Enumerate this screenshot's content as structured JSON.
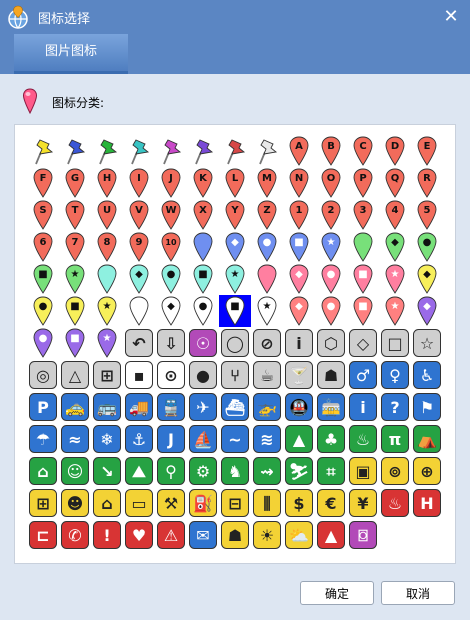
{
  "window": {
    "title": "图标选择",
    "close_glyph": "✕"
  },
  "tabs": [
    {
      "label": "图片图标",
      "active": true
    }
  ],
  "category": {
    "label": "图标分类:"
  },
  "buttons": {
    "ok": "确定",
    "cancel": "取消"
  },
  "selected_index": 71,
  "colors": {
    "titlebar": "#5b86c3",
    "selection": "#0000ff"
  },
  "icons": [
    {
      "kind": "thumbtack",
      "color": "#f5e12a"
    },
    {
      "kind": "thumbtack",
      "color": "#3b57d6"
    },
    {
      "kind": "thumbtack",
      "color": "#27b43a"
    },
    {
      "kind": "thumbtack",
      "color": "#38c4c4"
    },
    {
      "kind": "thumbtack",
      "color": "#c94ac9"
    },
    {
      "kind": "thumbtack",
      "color": "#7a4ad6"
    },
    {
      "kind": "thumbtack",
      "color": "#d64848"
    },
    {
      "kind": "thumbtack",
      "color": "#e8e8e8"
    },
    {
      "kind": "pin",
      "color": "#f26b5b",
      "glyph": "A"
    },
    {
      "kind": "pin",
      "color": "#f26b5b",
      "glyph": "B"
    },
    {
      "kind": "pin",
      "color": "#f26b5b",
      "glyph": "C"
    },
    {
      "kind": "pin",
      "color": "#f26b5b",
      "glyph": "D"
    },
    {
      "kind": "pin",
      "color": "#f26b5b",
      "glyph": "E"
    },
    {
      "kind": "pin",
      "color": "#f26b5b",
      "glyph": "F"
    },
    {
      "kind": "pin",
      "color": "#f26b5b",
      "glyph": "G"
    },
    {
      "kind": "pin",
      "color": "#f26b5b",
      "glyph": "H"
    },
    {
      "kind": "pin",
      "color": "#f26b5b",
      "glyph": "I"
    },
    {
      "kind": "pin",
      "color": "#f26b5b",
      "glyph": "J"
    },
    {
      "kind": "pin",
      "color": "#f26b5b",
      "glyph": "K"
    },
    {
      "kind": "pin",
      "color": "#f26b5b",
      "glyph": "L"
    },
    {
      "kind": "pin",
      "color": "#f26b5b",
      "glyph": "M"
    },
    {
      "kind": "pin",
      "color": "#f26b5b",
      "glyph": "N"
    },
    {
      "kind": "pin",
      "color": "#f26b5b",
      "glyph": "O"
    },
    {
      "kind": "pin",
      "color": "#f26b5b",
      "glyph": "P"
    },
    {
      "kind": "pin",
      "color": "#f26b5b",
      "glyph": "Q"
    },
    {
      "kind": "pin",
      "color": "#f26b5b",
      "glyph": "R"
    },
    {
      "kind": "pin",
      "color": "#f26b5b",
      "glyph": "S"
    },
    {
      "kind": "pin",
      "color": "#f26b5b",
      "glyph": "T"
    },
    {
      "kind": "pin",
      "color": "#f26b5b",
      "glyph": "U"
    },
    {
      "kind": "pin",
      "color": "#f26b5b",
      "glyph": "V"
    },
    {
      "kind": "pin",
      "color": "#f26b5b",
      "glyph": "W"
    },
    {
      "kind": "pin",
      "color": "#f26b5b",
      "glyph": "X"
    },
    {
      "kind": "pin",
      "color": "#f26b5b",
      "glyph": "Y"
    },
    {
      "kind": "pin",
      "color": "#f26b5b",
      "glyph": "Z"
    },
    {
      "kind": "pin",
      "color": "#f26b5b",
      "glyph": "1"
    },
    {
      "kind": "pin",
      "color": "#f26b5b",
      "glyph": "2"
    },
    {
      "kind": "pin",
      "color": "#f26b5b",
      "glyph": "3"
    },
    {
      "kind": "pin",
      "color": "#f26b5b",
      "glyph": "4"
    },
    {
      "kind": "pin",
      "color": "#f26b5b",
      "glyph": "5"
    },
    {
      "kind": "pin",
      "color": "#f26b5b",
      "glyph": "6"
    },
    {
      "kind": "pin",
      "color": "#f26b5b",
      "glyph": "7"
    },
    {
      "kind": "pin",
      "color": "#f26b5b",
      "glyph": "8"
    },
    {
      "kind": "pin",
      "color": "#f26b5b",
      "glyph": "9"
    },
    {
      "kind": "pin",
      "color": "#f26b5b",
      "glyph": "10"
    },
    {
      "kind": "pin",
      "color": "#6f8ff0",
      "glyph": ""
    },
    {
      "kind": "pin",
      "color": "#6f8ff0",
      "glyph": "◆"
    },
    {
      "kind": "pin",
      "color": "#6f8ff0",
      "glyph": "●"
    },
    {
      "kind": "pin",
      "color": "#6f8ff0",
      "glyph": "■"
    },
    {
      "kind": "pin",
      "color": "#6f8ff0",
      "glyph": "★"
    },
    {
      "kind": "pin",
      "color": "#78e07a",
      "glyph": ""
    },
    {
      "kind": "pin",
      "color": "#78e07a",
      "glyph": "◆"
    },
    {
      "kind": "pin",
      "color": "#78e07a",
      "glyph": "●"
    },
    {
      "kind": "pin",
      "color": "#78e07a",
      "glyph": "■"
    },
    {
      "kind": "pin",
      "color": "#78e07a",
      "glyph": "★"
    },
    {
      "kind": "pin",
      "color": "#8ef0e0",
      "glyph": ""
    },
    {
      "kind": "pin",
      "color": "#8ef0e0",
      "glyph": "◆"
    },
    {
      "kind": "pin",
      "color": "#8ef0e0",
      "glyph": "●"
    },
    {
      "kind": "pin",
      "color": "#8ef0e0",
      "glyph": "■"
    },
    {
      "kind": "pin",
      "color": "#8ef0e0",
      "glyph": "★"
    },
    {
      "kind": "pin",
      "color": "#ff7fa0",
      "glyph": ""
    },
    {
      "kind": "pin",
      "color": "#ff7fa0",
      "glyph": "◆"
    },
    {
      "kind": "pin",
      "color": "#ff7fa0",
      "glyph": "●"
    },
    {
      "kind": "pin",
      "color": "#ff7fa0",
      "glyph": "■"
    },
    {
      "kind": "pin",
      "color": "#ff7fa0",
      "glyph": "★"
    },
    {
      "kind": "pin",
      "color": "#f7ef5a",
      "glyph": "◆"
    },
    {
      "kind": "pin",
      "color": "#f7ef5a",
      "glyph": "●"
    },
    {
      "kind": "pin",
      "color": "#f7ef5a",
      "glyph": "■"
    },
    {
      "kind": "pin",
      "color": "#f7ef5a",
      "glyph": "★"
    },
    {
      "kind": "pin",
      "color": "#ffffff",
      "glyph": ""
    },
    {
      "kind": "pin",
      "color": "#ffffff",
      "glyph": "◆"
    },
    {
      "kind": "pin",
      "color": "#ffffff",
      "glyph": "●"
    },
    {
      "kind": "pin",
      "color": "#ffffff",
      "glyph": "■"
    },
    {
      "kind": "pin",
      "color": "#ffffff",
      "glyph": "★"
    },
    {
      "kind": "pin",
      "color": "#ff8080",
      "glyph": "◆"
    },
    {
      "kind": "pin",
      "color": "#ff8080",
      "glyph": "●"
    },
    {
      "kind": "pin",
      "color": "#ff8080",
      "glyph": "■"
    },
    {
      "kind": "pin",
      "color": "#ff8080",
      "glyph": "★"
    },
    {
      "kind": "pin",
      "color": "#9a6ae8",
      "glyph": "◆"
    },
    {
      "kind": "pin",
      "color": "#9a6ae8",
      "glyph": "●"
    },
    {
      "kind": "pin",
      "color": "#9a6ae8",
      "glyph": "■"
    },
    {
      "kind": "pin",
      "color": "#9a6ae8",
      "glyph": "★"
    },
    {
      "kind": "tile",
      "icon": "curved-arrow"
    },
    {
      "kind": "tile",
      "icon": "down-arrow"
    },
    {
      "kind": "tile",
      "icon": "ghost-face"
    },
    {
      "kind": "tile",
      "icon": "ring"
    },
    {
      "kind": "tile",
      "icon": "no-sign"
    },
    {
      "kind": "tile",
      "icon": "info"
    },
    {
      "kind": "tile",
      "icon": "hexagon"
    },
    {
      "kind": "tile",
      "icon": "diamond"
    },
    {
      "kind": "tile",
      "icon": "square"
    },
    {
      "kind": "tile",
      "icon": "star"
    },
    {
      "kind": "tile",
      "icon": "target"
    },
    {
      "kind": "tile",
      "icon": "triangle"
    },
    {
      "kind": "tile",
      "icon": "crosshair"
    },
    {
      "kind": "tile",
      "icon": "black-square"
    },
    {
      "kind": "tile",
      "icon": "dot-circle"
    },
    {
      "kind": "tile",
      "icon": "gray-ball"
    },
    {
      "kind": "tile",
      "icon": "fork-knife"
    },
    {
      "kind": "tile",
      "icon": "coffee"
    },
    {
      "kind": "tile",
      "icon": "cocktail"
    },
    {
      "kind": "tile",
      "icon": "fastfood"
    },
    {
      "kind": "tile",
      "icon": "man"
    },
    {
      "kind": "tile",
      "icon": "woman"
    },
    {
      "kind": "tile",
      "icon": "wheelchair"
    },
    {
      "kind": "tile",
      "icon": "parking"
    },
    {
      "kind": "tile",
      "icon": "taxi"
    },
    {
      "kind": "tile",
      "icon": "bus"
    },
    {
      "kind": "tile",
      "icon": "truck"
    },
    {
      "kind": "tile",
      "icon": "train"
    },
    {
      "kind": "tile",
      "icon": "airplane"
    },
    {
      "kind": "tile",
      "icon": "ship"
    },
    {
      "kind": "tile",
      "icon": "helicopter"
    },
    {
      "kind": "tile",
      "icon": "subway"
    },
    {
      "kind": "tile",
      "icon": "tram"
    },
    {
      "kind": "tile",
      "icon": "info-blue"
    },
    {
      "kind": "tile",
      "icon": "help"
    },
    {
      "kind": "tile",
      "icon": "flag"
    },
    {
      "kind": "tile",
      "icon": "rain"
    },
    {
      "kind": "tile",
      "icon": "waves"
    },
    {
      "kind": "tile",
      "icon": "snowflake"
    },
    {
      "kind": "tile",
      "icon": "anchor"
    },
    {
      "kind": "tile",
      "icon": "fishing"
    },
    {
      "kind": "tile",
      "icon": "sailboat"
    },
    {
      "kind": "tile",
      "icon": "swimming"
    },
    {
      "kind": "tile",
      "icon": "surfing"
    },
    {
      "kind": "tile",
      "icon": "tree"
    },
    {
      "kind": "tile",
      "icon": "forest"
    },
    {
      "kind": "tile",
      "icon": "campfire"
    },
    {
      "kind": "tile",
      "icon": "picnic"
    },
    {
      "kind": "tile",
      "icon": "tent"
    },
    {
      "kind": "tile",
      "icon": "home"
    },
    {
      "kind": "tile",
      "icon": "family"
    },
    {
      "kind": "tile",
      "icon": "trail-arrow"
    },
    {
      "kind": "tile",
      "icon": "hiking"
    },
    {
      "kind": "tile",
      "icon": "cycling"
    },
    {
      "kind": "tile",
      "icon": "motorbike"
    },
    {
      "kind": "tile",
      "icon": "horse"
    },
    {
      "kind": "tile",
      "icon": "running"
    },
    {
      "kind": "tile",
      "icon": "skiing"
    },
    {
      "kind": "tile",
      "icon": "map"
    },
    {
      "kind": "tile",
      "icon": "shopping-bag"
    },
    {
      "kind": "tile",
      "icon": "film"
    },
    {
      "kind": "tile",
      "icon": "grocery"
    },
    {
      "kind": "tile",
      "icon": "basket"
    },
    {
      "kind": "tile",
      "icon": "theater"
    },
    {
      "kind": "tile",
      "icon": "house-outline"
    },
    {
      "kind": "tile",
      "icon": "tv"
    },
    {
      "kind": "tile",
      "icon": "wrench"
    },
    {
      "kind": "tile",
      "icon": "fuel"
    },
    {
      "kind": "tile",
      "icon": "sign"
    },
    {
      "kind": "tile",
      "icon": "bank"
    },
    {
      "kind": "tile",
      "icon": "dollar"
    },
    {
      "kind": "tile",
      "icon": "euro"
    },
    {
      "kind": "tile",
      "icon": "yen"
    },
    {
      "kind": "tile",
      "icon": "fire"
    },
    {
      "kind": "tile",
      "icon": "hospital"
    },
    {
      "kind": "tile",
      "icon": "bed"
    },
    {
      "kind": "tile",
      "icon": "phone"
    },
    {
      "kind": "tile",
      "icon": "warning"
    },
    {
      "kind": "tile",
      "icon": "heartbeat"
    },
    {
      "kind": "tile",
      "icon": "caution"
    },
    {
      "kind": "tile",
      "icon": "mail"
    },
    {
      "kind": "tile",
      "icon": "postman"
    },
    {
      "kind": "tile",
      "icon": "sun"
    },
    {
      "kind": "tile",
      "icon": "partly-sunny"
    },
    {
      "kind": "tile",
      "icon": "volcano"
    },
    {
      "kind": "tile",
      "icon": "camera"
    }
  ]
}
